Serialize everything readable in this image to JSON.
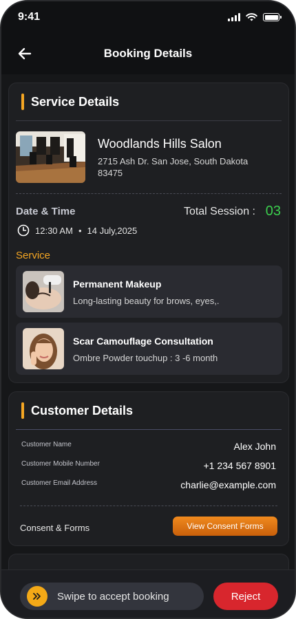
{
  "status_bar": {
    "time": "9:41"
  },
  "header": {
    "title": "Booking Details",
    "back_icon": "arrow-left-icon"
  },
  "service_details": {
    "title": "Service Details",
    "salon": {
      "name": "Woodlands Hills Salon",
      "address": "2715 Ash Dr. San Jose, South Dakota 83475"
    },
    "date_time_label": "Date & Time",
    "total_session_label": "Total Session :",
    "total_session_value": "03",
    "time": "12:30 AM",
    "separator": "•",
    "date": "14 July,2025",
    "service_label": "Service",
    "services": [
      {
        "name": "Permanent Makeup",
        "description": "Long-lasting beauty for brows, eyes,."
      },
      {
        "name": "Scar Camouflage Consultation",
        "description": "Ombre Powder touchup : 3 -6 month"
      }
    ]
  },
  "customer_details": {
    "title": "Customer Details",
    "rows": [
      {
        "label": "Customer Name",
        "value": "Alex John"
      },
      {
        "label": "Customer Mobile Number",
        "value": "+1 234 567 8901"
      },
      {
        "label": "Customer Email Address",
        "value": "charlie@example.com"
      }
    ],
    "consent_label": "Consent & Forms",
    "consent_button": "View Consent Forms"
  },
  "actions": {
    "swipe_text": "Swipe to accept booking",
    "swipe_icon": "double-chevron-right-icon",
    "reject_label": "Reject"
  },
  "colors": {
    "accent": "#f5a623",
    "session_green": "#3ccf4e",
    "reject_red": "#d8262d",
    "background": "#101113"
  }
}
